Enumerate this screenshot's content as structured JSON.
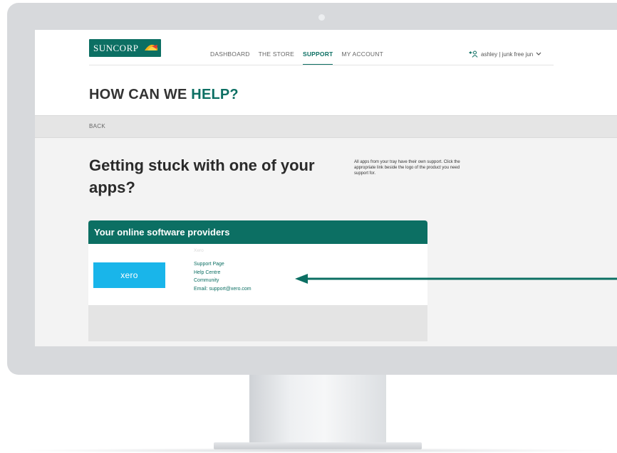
{
  "brand": {
    "name": "SUNCORP",
    "color": "#0c6f63"
  },
  "nav": {
    "items": [
      {
        "label": "DASHBOARD",
        "active": false
      },
      {
        "label": "THE STORE",
        "active": false
      },
      {
        "label": "SUPPORT",
        "active": true
      },
      {
        "label": "MY ACCOUNT",
        "active": false
      }
    ],
    "account_label": "ashley | junk free jun",
    "account_icon": "user-switch-icon",
    "dropdown_icon": "chevron-down-icon"
  },
  "page": {
    "title_prefix": "HOW CAN WE ",
    "title_accent": "HELP?",
    "back_label": "BACK",
    "headline": "Getting stuck with one of your apps?",
    "side_note": "All apps from your tray have their own support. Click the appropriate link beside the logo of the product you need support for."
  },
  "providers": {
    "header": "Your online software providers",
    "items": [
      {
        "logo_text": "xero",
        "name": "Xero",
        "links": [
          "Support Page",
          "Help Centre",
          "Community",
          "Email: support@xero.com"
        ]
      }
    ]
  },
  "colors": {
    "accent": "#0c6f63",
    "xero_blue": "#19b5ea"
  }
}
